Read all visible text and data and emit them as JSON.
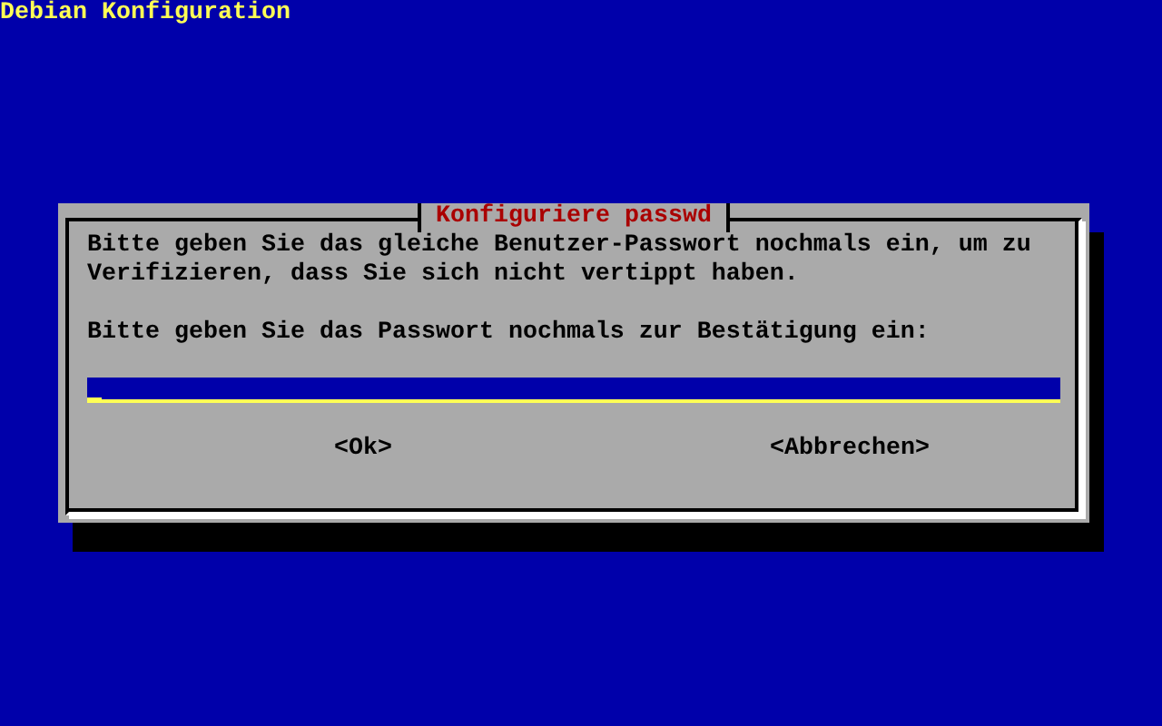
{
  "screen_title": "Debian Konfiguration",
  "dialog": {
    "title": "Konfiguriere passwd",
    "paragraphs": [
      "Bitte geben Sie das gleiche Benutzer-Passwort nochmals ein, um zu Verifizieren, dass Sie sich nicht vertippt haben.",
      "Bitte geben Sie das Passwort nochmals zur Bestätigung ein:"
    ],
    "password_field": {
      "focused": true
    },
    "buttons": [
      "<Ok>",
      "<Abbrechen>"
    ]
  }
}
